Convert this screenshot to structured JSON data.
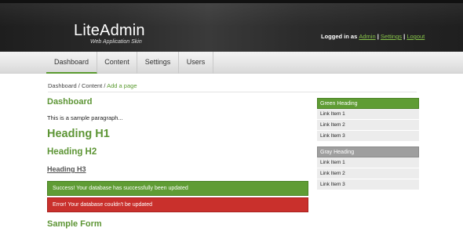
{
  "header": {
    "title": "LiteAdmin",
    "tagline": "Web Application Skin",
    "logged_in_as": "Logged in as",
    "user_link": "Admin",
    "sep1": "|",
    "settings_link": "Settings",
    "sep2": "|",
    "logout_link": "Logout"
  },
  "nav": {
    "items": [
      {
        "label": "Dashboard"
      },
      {
        "label": "Content"
      },
      {
        "label": "Settings"
      },
      {
        "label": "Users"
      }
    ]
  },
  "breadcrumb": {
    "part1": "Dashboard",
    "sep1": "/",
    "part2": "Content",
    "sep2": "/",
    "current": "Add a page"
  },
  "main": {
    "heading": "Dashboard",
    "paragraph": "This is a sample paragraph...",
    "h1": "Heading H1",
    "h2": "Heading H2",
    "h3": "Heading H3",
    "success_msg": "Success! Your database has successfully been updated",
    "error_msg": "Error! Your database couldn't be updated",
    "form_heading": "Sample Form"
  },
  "sidebar": {
    "green_panel": {
      "heading": "Green Heading",
      "items": [
        "Link Item 1",
        "Link Item 2",
        "Link Item 3"
      ]
    },
    "gray_panel": {
      "heading": "Gray Heading",
      "items": [
        "Link Item 1",
        "Link Item 2",
        "Link Item 3"
      ]
    }
  },
  "colors": {
    "accent_green": "#5d9535",
    "error_red": "#c9302c",
    "header_dark": "#2a2a2a"
  }
}
